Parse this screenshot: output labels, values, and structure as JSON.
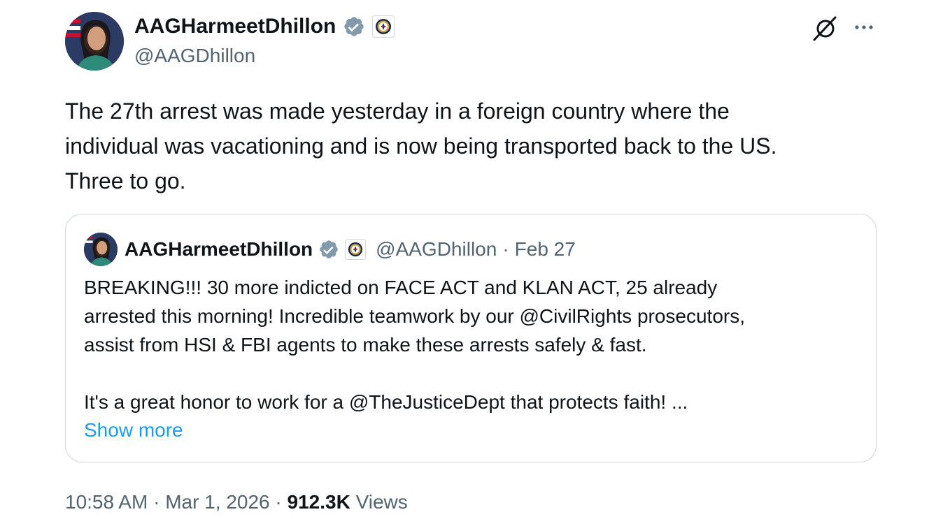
{
  "author": {
    "display_name": "AAGHarmeetDhillon",
    "handle": "@AAGDhillon",
    "verified_icon": "verified-badge-icon",
    "affiliation_icon": "doj-seal-icon"
  },
  "tweet": {
    "text": "The 27th arrest was made yesterday in a foreign country where the\nindividual was vacationing and is now being transported back to the US.\nThree to go."
  },
  "quoted_tweet": {
    "display_name": "AAGHarmeetDhillon",
    "handle": "@AAGDhillon",
    "separator": "·",
    "date": "Feb 27",
    "text": "BREAKING!!! 30 more indicted on FACE ACT and KLAN ACT, 25 already\narrested this morning! Incredible teamwork by our @CivilRights prosecutors,\nassist from HSI & FBI agents to make these arrests safely & fast.\n\nIt's a great honor to work for a @TheJusticeDept that protects faith! ...",
    "show_more_label": "Show more"
  },
  "footer": {
    "time": "10:58 AM",
    "separator": "·",
    "date": "Mar 1, 2026",
    "views_count": "912.3K",
    "views_label": "Views"
  },
  "icons": {
    "grok": "grok-icon",
    "more": "more-options-icon"
  },
  "colors": {
    "text": "#0f1419",
    "secondary": "#536471",
    "link": "#1d9bf0",
    "border": "#cfd9de",
    "verified": "#829aab"
  }
}
